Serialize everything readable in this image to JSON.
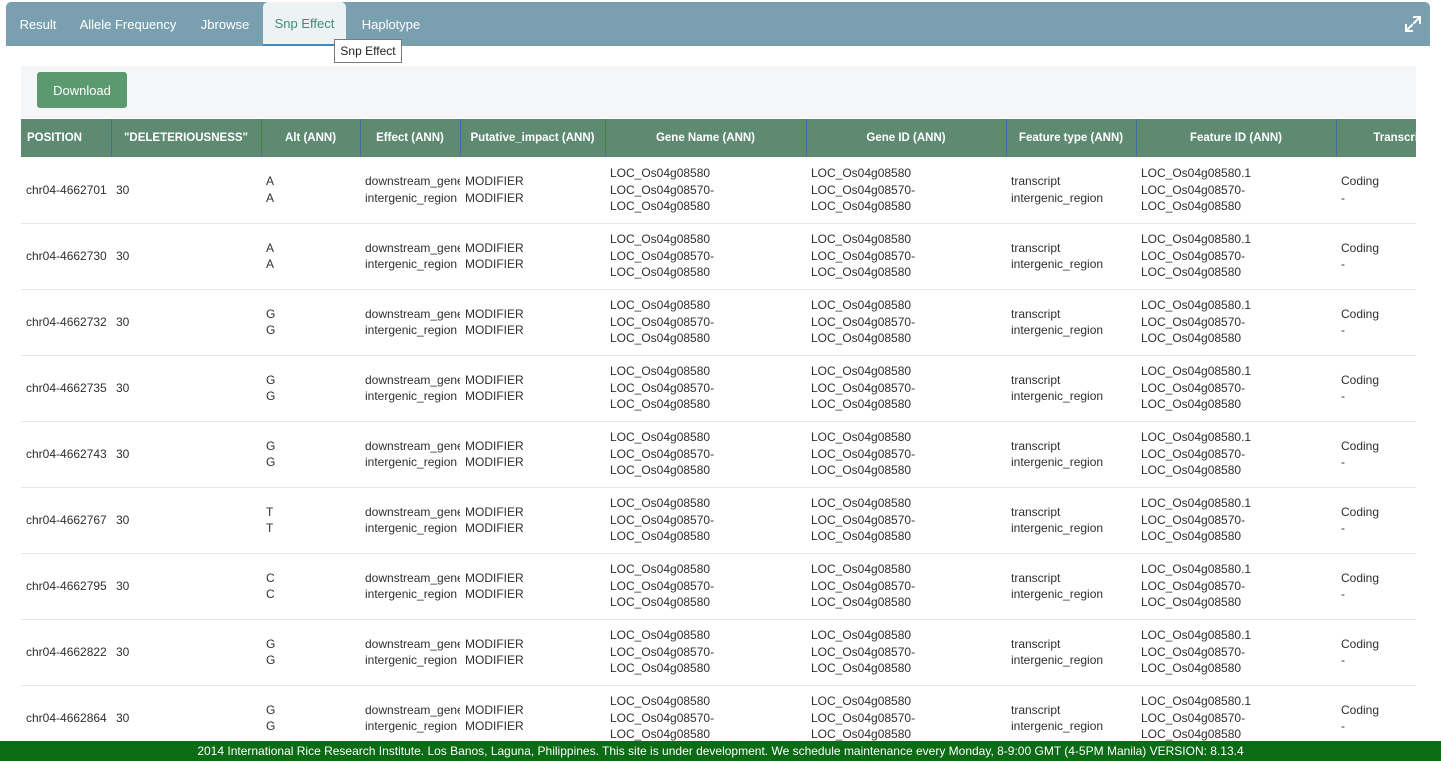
{
  "tabs": [
    {
      "label": "Result"
    },
    {
      "label": "Allele Frequency"
    },
    {
      "label": "Jbrowse"
    },
    {
      "label": "Snp Effect"
    },
    {
      "label": "Haplotype"
    }
  ],
  "active_tab": "Snp Effect",
  "tooltip": "Snp Effect",
  "toolbar": {
    "download_label": "Download"
  },
  "table": {
    "headers": [
      "POSITION",
      "\"DELETERIOUSNESS\"",
      "Alt (ANN)",
      "Effect (ANN)",
      "Putative_impact (ANN)",
      "Gene Name (ANN)",
      "Gene ID (ANN)",
      "Feature type (ANN)",
      "Feature ID (ANN)",
      "Transcript Bi"
    ],
    "rows": [
      {
        "position": "chr04-4662701",
        "del": "30",
        "alt": [
          "A",
          "A"
        ],
        "effect": [
          "downstream_gene",
          "intergenic_region"
        ],
        "impact": [
          "MODIFIER",
          "MODIFIER"
        ],
        "gene_name": [
          "LOC_Os04g08580",
          "LOC_Os04g08570-",
          "LOC_Os04g08580"
        ],
        "gene_id": [
          "LOC_Os04g08580",
          "LOC_Os04g08570-",
          "LOC_Os04g08580"
        ],
        "feature_type": [
          "transcript",
          "intergenic_region"
        ],
        "feature_id": [
          "LOC_Os04g08580.1",
          "LOC_Os04g08570-",
          "LOC_Os04g08580"
        ],
        "biotype": [
          "Coding",
          "-"
        ]
      },
      {
        "position": "chr04-4662730",
        "del": "30",
        "alt": [
          "A",
          "A"
        ],
        "effect": [
          "downstream_gene",
          "intergenic_region"
        ],
        "impact": [
          "MODIFIER",
          "MODIFIER"
        ],
        "gene_name": [
          "LOC_Os04g08580",
          "LOC_Os04g08570-",
          "LOC_Os04g08580"
        ],
        "gene_id": [
          "LOC_Os04g08580",
          "LOC_Os04g08570-",
          "LOC_Os04g08580"
        ],
        "feature_type": [
          "transcript",
          "intergenic_region"
        ],
        "feature_id": [
          "LOC_Os04g08580.1",
          "LOC_Os04g08570-",
          "LOC_Os04g08580"
        ],
        "biotype": [
          "Coding",
          "-"
        ]
      },
      {
        "position": "chr04-4662732",
        "del": "30",
        "alt": [
          "G",
          "G"
        ],
        "effect": [
          "downstream_gene",
          "intergenic_region"
        ],
        "impact": [
          "MODIFIER",
          "MODIFIER"
        ],
        "gene_name": [
          "LOC_Os04g08580",
          "LOC_Os04g08570-",
          "LOC_Os04g08580"
        ],
        "gene_id": [
          "LOC_Os04g08580",
          "LOC_Os04g08570-",
          "LOC_Os04g08580"
        ],
        "feature_type": [
          "transcript",
          "intergenic_region"
        ],
        "feature_id": [
          "LOC_Os04g08580.1",
          "LOC_Os04g08570-",
          "LOC_Os04g08580"
        ],
        "biotype": [
          "Coding",
          "-"
        ]
      },
      {
        "position": "chr04-4662735",
        "del": "30",
        "alt": [
          "G",
          "G"
        ],
        "effect": [
          "downstream_gene",
          "intergenic_region"
        ],
        "impact": [
          "MODIFIER",
          "MODIFIER"
        ],
        "gene_name": [
          "LOC_Os04g08580",
          "LOC_Os04g08570-",
          "LOC_Os04g08580"
        ],
        "gene_id": [
          "LOC_Os04g08580",
          "LOC_Os04g08570-",
          "LOC_Os04g08580"
        ],
        "feature_type": [
          "transcript",
          "intergenic_region"
        ],
        "feature_id": [
          "LOC_Os04g08580.1",
          "LOC_Os04g08570-",
          "LOC_Os04g08580"
        ],
        "biotype": [
          "Coding",
          "-"
        ]
      },
      {
        "position": "chr04-4662743",
        "del": "30",
        "alt": [
          "G",
          "G"
        ],
        "effect": [
          "downstream_gene",
          "intergenic_region"
        ],
        "impact": [
          "MODIFIER",
          "MODIFIER"
        ],
        "gene_name": [
          "LOC_Os04g08580",
          "LOC_Os04g08570-",
          "LOC_Os04g08580"
        ],
        "gene_id": [
          "LOC_Os04g08580",
          "LOC_Os04g08570-",
          "LOC_Os04g08580"
        ],
        "feature_type": [
          "transcript",
          "intergenic_region"
        ],
        "feature_id": [
          "LOC_Os04g08580.1",
          "LOC_Os04g08570-",
          "LOC_Os04g08580"
        ],
        "biotype": [
          "Coding",
          "-"
        ]
      },
      {
        "position": "chr04-4662767",
        "del": "30",
        "alt": [
          "T",
          "T"
        ],
        "effect": [
          "downstream_gene",
          "intergenic_region"
        ],
        "impact": [
          "MODIFIER",
          "MODIFIER"
        ],
        "gene_name": [
          "LOC_Os04g08580",
          "LOC_Os04g08570-",
          "LOC_Os04g08580"
        ],
        "gene_id": [
          "LOC_Os04g08580",
          "LOC_Os04g08570-",
          "LOC_Os04g08580"
        ],
        "feature_type": [
          "transcript",
          "intergenic_region"
        ],
        "feature_id": [
          "LOC_Os04g08580.1",
          "LOC_Os04g08570-",
          "LOC_Os04g08580"
        ],
        "biotype": [
          "Coding",
          "-"
        ]
      },
      {
        "position": "chr04-4662795",
        "del": "30",
        "alt": [
          "C",
          "C"
        ],
        "effect": [
          "downstream_gene",
          "intergenic_region"
        ],
        "impact": [
          "MODIFIER",
          "MODIFIER"
        ],
        "gene_name": [
          "LOC_Os04g08580",
          "LOC_Os04g08570-",
          "LOC_Os04g08580"
        ],
        "gene_id": [
          "LOC_Os04g08580",
          "LOC_Os04g08570-",
          "LOC_Os04g08580"
        ],
        "feature_type": [
          "transcript",
          "intergenic_region"
        ],
        "feature_id": [
          "LOC_Os04g08580.1",
          "LOC_Os04g08570-",
          "LOC_Os04g08580"
        ],
        "biotype": [
          "Coding",
          "-"
        ]
      },
      {
        "position": "chr04-4662822",
        "del": "30",
        "alt": [
          "G",
          "G"
        ],
        "effect": [
          "downstream_gene",
          "intergenic_region"
        ],
        "impact": [
          "MODIFIER",
          "MODIFIER"
        ],
        "gene_name": [
          "LOC_Os04g08580",
          "LOC_Os04g08570-",
          "LOC_Os04g08580"
        ],
        "gene_id": [
          "LOC_Os04g08580",
          "LOC_Os04g08570-",
          "LOC_Os04g08580"
        ],
        "feature_type": [
          "transcript",
          "intergenic_region"
        ],
        "feature_id": [
          "LOC_Os04g08580.1",
          "LOC_Os04g08570-",
          "LOC_Os04g08580"
        ],
        "biotype": [
          "Coding",
          "-"
        ]
      },
      {
        "position": "chr04-4662864",
        "del": "30",
        "alt": [
          "G",
          "G"
        ],
        "effect": [
          "downstream_gene",
          "intergenic_region"
        ],
        "impact": [
          "MODIFIER",
          "MODIFIER"
        ],
        "gene_name": [
          "LOC_Os04g08580",
          "LOC_Os04g08570-",
          "LOC_Os04g08580"
        ],
        "gene_id": [
          "LOC_Os04g08580",
          "LOC_Os04g08570-",
          "LOC_Os04g08580"
        ],
        "feature_type": [
          "transcript",
          "intergenic_region"
        ],
        "feature_id": [
          "LOC_Os04g08580.1",
          "LOC_Os04g08570-",
          "LOC_Os04g08580"
        ],
        "biotype": [
          "Coding",
          "-"
        ]
      }
    ]
  },
  "icons": {
    "expand": "expand-icon"
  },
  "colors": {
    "tabbar": "#7aa0b0",
    "active_tab_text": "#3c8d73",
    "download_button": "#5b9a6f",
    "table_header": "#5e8a72",
    "footer": "#0c6b15"
  },
  "footer": {
    "text": "2014 International Rice Research Institute. Los Banos, Laguna, Philippines. This site is under development. We schedule maintenance every Monday, 8-9:00 GMT (4-5PM Manila) VERSION: 8.13.4"
  }
}
